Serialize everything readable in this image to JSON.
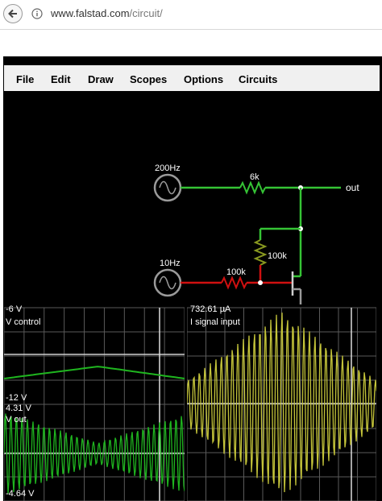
{
  "browser": {
    "url_host": "www.falstad.com",
    "url_path": "/circuit/"
  },
  "menu": {
    "items": [
      "File",
      "Edit",
      "Draw",
      "Scopes",
      "Options",
      "Circuits"
    ]
  },
  "circuit": {
    "source_top_label": "200Hz",
    "source_bottom_label": "10Hz",
    "resistor_series_label": "6k",
    "resistor_vertical_label": "100k",
    "resistor_gate_label": "100k",
    "output_label": "out"
  },
  "scopes": {
    "left": {
      "top_max": "-6 V",
      "top_name": "V control",
      "top_min": "-12 V",
      "bottom_max": "4.31 V",
      "bottom_name": "V out",
      "bottom_min": "-4.64 V"
    },
    "right": {
      "max": "732.61 µA",
      "name": "I signal input"
    }
  },
  "colors": {
    "wire_green": "#35c435",
    "wire_red": "#d01010",
    "wire_gray": "#9a9a9a",
    "trace_green": "#1fb51f",
    "trace_yellow": "#c4c43a",
    "grid": "#5a5a5a"
  }
}
